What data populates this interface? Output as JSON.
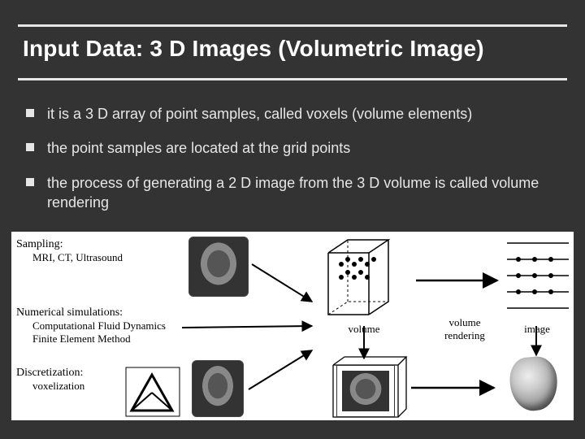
{
  "title": "Input Data: 3 D Images (Volumetric Image)",
  "bullets": [
    "it is a 3 D array of point samples, called voxels (volume elements)",
    "the point samples are located at the grid points",
    "the process of generating a 2 D image from the 3 D volume is called volume rendering"
  ],
  "figure": {
    "sampling": {
      "header": "Sampling:",
      "lines": [
        "MRI, CT, Ultrasound"
      ]
    },
    "numsim": {
      "header": "Numerical simulations:",
      "lines": [
        "Computational Fluid Dynamics",
        "Finite Element Method"
      ]
    },
    "discret": {
      "header": "Discretization:",
      "lines": [
        "voxelization"
      ]
    },
    "labels": {
      "volume": "volume",
      "volume_rendering": "volume rendering",
      "image": "image"
    }
  }
}
